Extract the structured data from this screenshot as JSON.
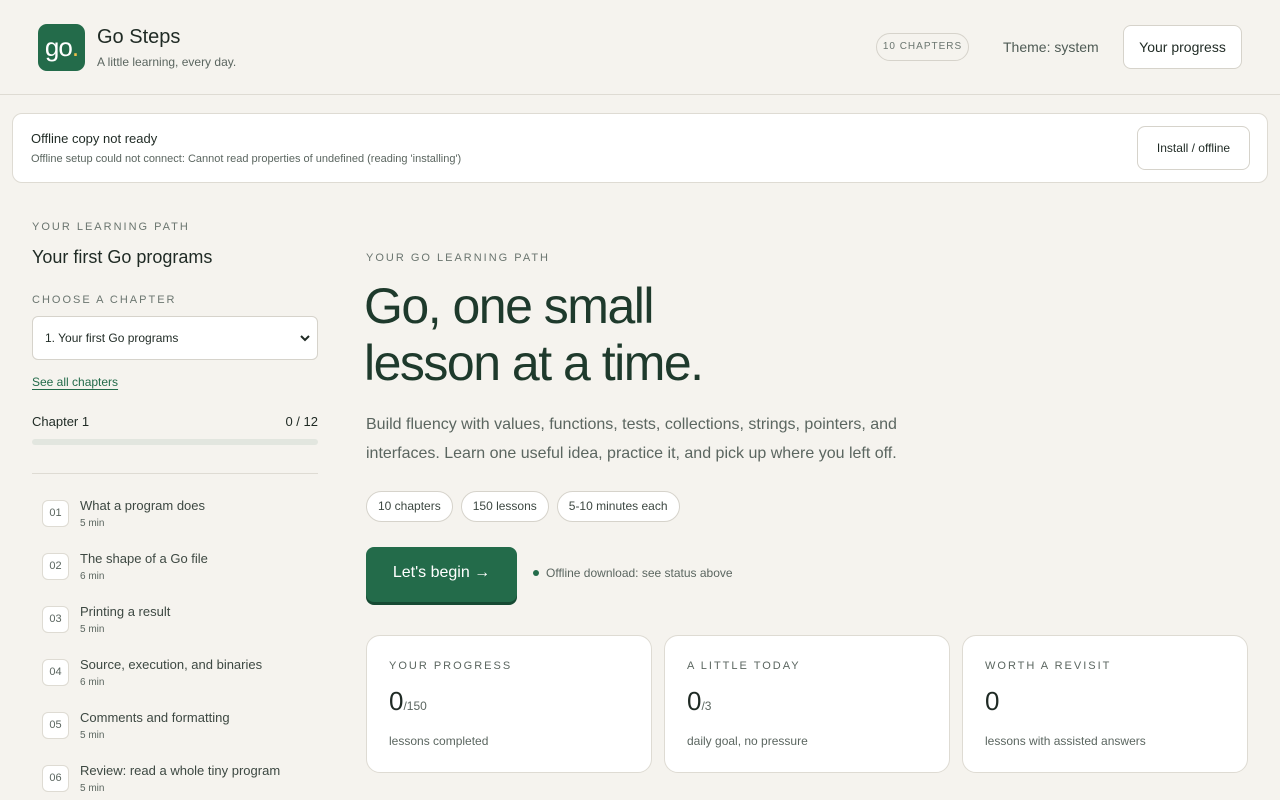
{
  "header": {
    "logo_text": "go",
    "logo_dot": ".",
    "title": "Go Steps",
    "subtitle": "A little learning, every day.",
    "chapters_badge": "10 CHAPTERS",
    "theme_label": "Theme: system",
    "progress_button": "Your progress"
  },
  "banner": {
    "title": "Offline copy not ready",
    "message": "Offline setup could not connect: Cannot read properties of undefined (reading 'installing')",
    "button": "Install / offline"
  },
  "sidebar": {
    "eyebrow": "YOUR LEARNING PATH",
    "title": "Your first Go programs",
    "choose_label": "CHOOSE A CHAPTER",
    "selected_chapter": "1. Your first Go programs",
    "see_all": "See all chapters",
    "chapter_label": "Chapter 1",
    "chapter_count": "0 / 12",
    "chapter_progress": 0,
    "lessons": [
      {
        "num": "01",
        "title": "What a program does",
        "duration": "5 min"
      },
      {
        "num": "02",
        "title": "The shape of a Go file",
        "duration": "6 min"
      },
      {
        "num": "03",
        "title": "Printing a result",
        "duration": "5 min"
      },
      {
        "num": "04",
        "title": "Source, execution, and binaries",
        "duration": "6 min"
      },
      {
        "num": "05",
        "title": "Comments and formatting",
        "duration": "5 min"
      },
      {
        "num": "06",
        "title": "Review: read a whole tiny program",
        "duration": "5 min"
      }
    ]
  },
  "main": {
    "eyebrow": "YOUR GO LEARNING PATH",
    "title_line1": "Go, one small",
    "title_line2": "lesson at a time.",
    "description": "Build fluency with values, functions, tests, collections, strings, pointers, and interfaces. Learn one useful idea, practice it, and pick up where you left off.",
    "pills": [
      "10 chapters",
      "150 lessons",
      "5-10 minutes each"
    ],
    "begin_button": "Let's begin →",
    "download_status": "Offline download: see status above",
    "stats": [
      {
        "eyebrow": "YOUR PROGRESS",
        "value": "0",
        "denominator": "/150",
        "caption": "lessons completed"
      },
      {
        "eyebrow": "A LITTLE TODAY",
        "value": "0",
        "denominator": "/3",
        "caption": "daily goal, no pressure"
      },
      {
        "eyebrow": "WORTH A REVISIT",
        "value": "0",
        "denominator": "",
        "caption": "lessons with assisted answers"
      }
    ]
  },
  "colors": {
    "accent": "#236b4a",
    "background": "#f5f3ee",
    "logo_dot": "#f0c04a"
  }
}
